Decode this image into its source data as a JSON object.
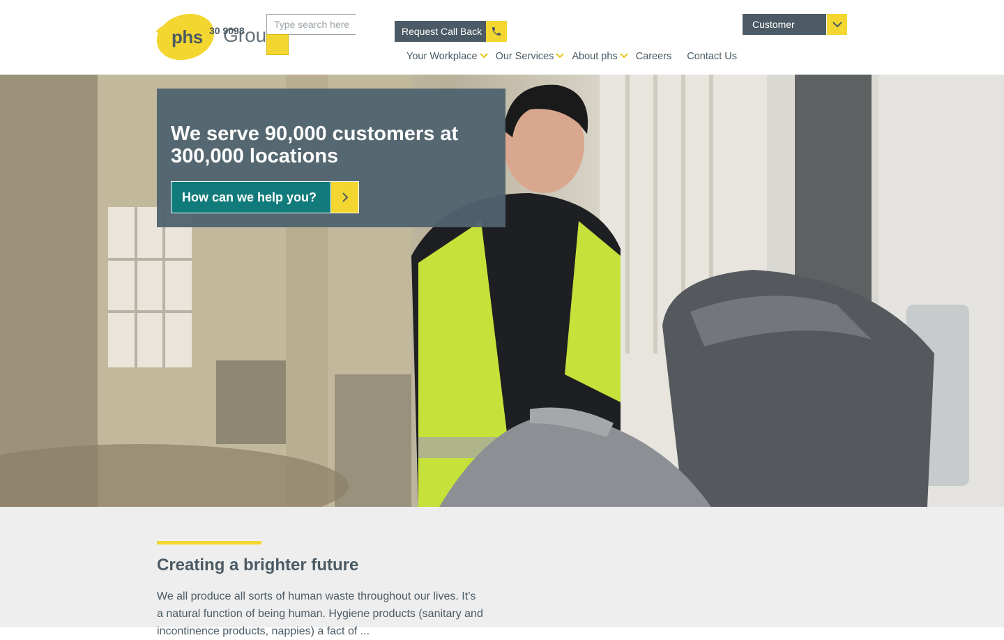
{
  "header": {
    "logo_text": "phs",
    "logo_group": "Group",
    "phone_overlap": "30 9098",
    "search_placeholder": "Type search here",
    "callback_label": "Request Call Back",
    "login_label": "Customer Login"
  },
  "nav": {
    "items": [
      {
        "label": "Your Workplace",
        "has_submenu": true
      },
      {
        "label": "Our Services",
        "has_submenu": true
      },
      {
        "label": "About phs",
        "has_submenu": true
      },
      {
        "label": "Careers",
        "has_submenu": false
      },
      {
        "label": "Contact Us",
        "has_submenu": false
      }
    ]
  },
  "hero": {
    "line1_pre": "We serve ",
    "line1_bold": "90,000",
    "line1_post": " customers at",
    "line2_bold": "300,000",
    "line2_post": " locations",
    "cta_label": "How can we help you?"
  },
  "section": {
    "title": "Creating a brighter future",
    "body": "We all produce all sorts of human waste throughout our lives. It’s a natural function of being human. Hygiene products (sanitary and incontinence products, nappies) a fact of ..."
  },
  "colors": {
    "brand_yellow": "#f4d630",
    "brand_slate": "#4b5a64",
    "cta_teal": "#117a7a",
    "section_bg": "#eeeeee"
  },
  "icons": {
    "callback": "phone-icon",
    "login": "chevron-down-icon",
    "cta": "chevron-right-icon",
    "nav_submenu": "chevron-down-icon",
    "search": "search-icon"
  }
}
